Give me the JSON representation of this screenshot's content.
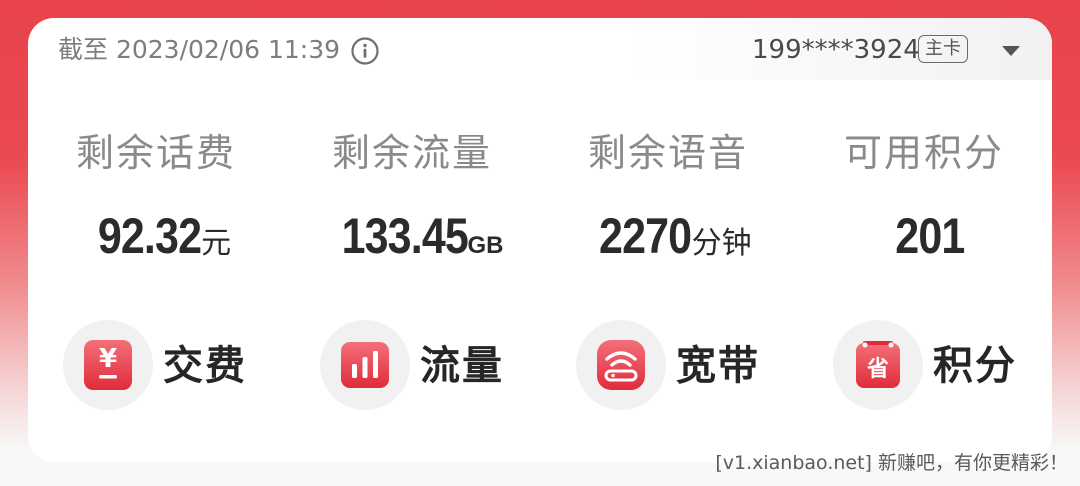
{
  "header": {
    "timestamp": "截至 2023/02/06 11:39",
    "phone": "199****3924",
    "badge": "主卡",
    "icons": [
      "info-icon",
      "dropdown-caret-icon"
    ]
  },
  "stats": [
    {
      "label": "剩余话费",
      "value": "92.32",
      "unit": "元"
    },
    {
      "label": "剩余流量",
      "value": "133.45",
      "unit": "GB"
    },
    {
      "label": "剩余语音",
      "value": "2270",
      "unit": "分钟"
    },
    {
      "label": "可用积分",
      "value": "201",
      "unit": ""
    }
  ],
  "actions": [
    {
      "label": "交费",
      "icon": "yuan-icon",
      "glyph": "¥"
    },
    {
      "label": "流量",
      "icon": "bar-chart-icon"
    },
    {
      "label": "宽带",
      "icon": "router-icon"
    },
    {
      "label": "积分",
      "icon": "save-icon",
      "glyph": "省"
    }
  ],
  "watermark": "[v1.xianbao.net] 新赚吧，有你更精彩！",
  "colors": {
    "accent": "#e8434a",
    "icon_red": "#e63a45",
    "icon_red_light": "#f2707a"
  }
}
